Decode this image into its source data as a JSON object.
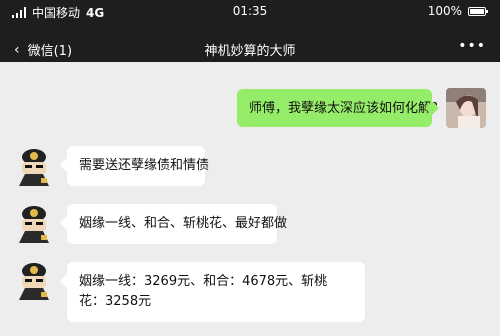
{
  "status_bar": {
    "carrier": "中国移动",
    "network": "4G",
    "time": "01:35",
    "battery": "100%",
    "battery_level": 1.0
  },
  "nav": {
    "back_label": "微信(1)",
    "title": "神机妙算的大师",
    "more_icon": "more-dots-icon"
  },
  "messages": [
    {
      "side": "right",
      "text": "师傅，我孽缘太深应该如何化解?"
    },
    {
      "side": "left",
      "text": "需要送还孽缘债和情债"
    },
    {
      "side": "left",
      "text": "姻缘一线、和合、斩桃花、最好都做"
    },
    {
      "side": "left",
      "text": "姻缘一线：3269元、和合：4678元、斩桃花：3258元"
    }
  ],
  "colors": {
    "header_bg": "#1e1e1e",
    "chat_bg": "#ededed",
    "my_bubble": "#95ec69",
    "other_bubble": "#ffffff"
  }
}
